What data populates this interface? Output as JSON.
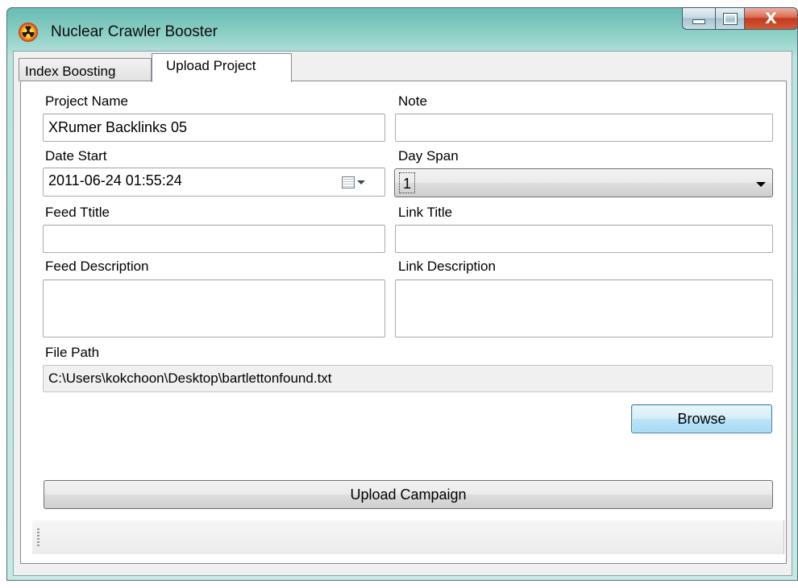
{
  "window": {
    "title": "Nuclear Crawler Booster",
    "close_glyph": "X",
    "icon": "radiation-icon"
  },
  "tabs": [
    {
      "label": "Index Boosting",
      "active": false
    },
    {
      "label": "Upload Project",
      "active": true
    }
  ],
  "form": {
    "project_name_label": "Project Name",
    "project_name_value": "XRumer Backlinks 05",
    "note_label": "Note",
    "note_value": "",
    "date_start_label": "Date Start",
    "date_start_value": "2011-06-24 01:55:24",
    "day_span_label": "Day Span",
    "day_span_value": "1",
    "feed_title_label": "Feed Ttitle",
    "feed_title_value": "",
    "link_title_label": "Link Title",
    "link_title_value": "",
    "feed_description_label": "Feed Description",
    "feed_description_value": "",
    "link_description_label": "Link Description",
    "link_description_value": "",
    "file_path_label": "File Path",
    "file_path_value": "C:\\Users\\kokchoon\\Desktop\\bartlettonfound.txt"
  },
  "buttons": {
    "browse": "Browse",
    "upload_campaign": "Upload Campaign"
  },
  "colors": {
    "title_bar": "#8fd0c6",
    "close_button": "#c3391f",
    "focus_border": "#3c7fb1"
  }
}
